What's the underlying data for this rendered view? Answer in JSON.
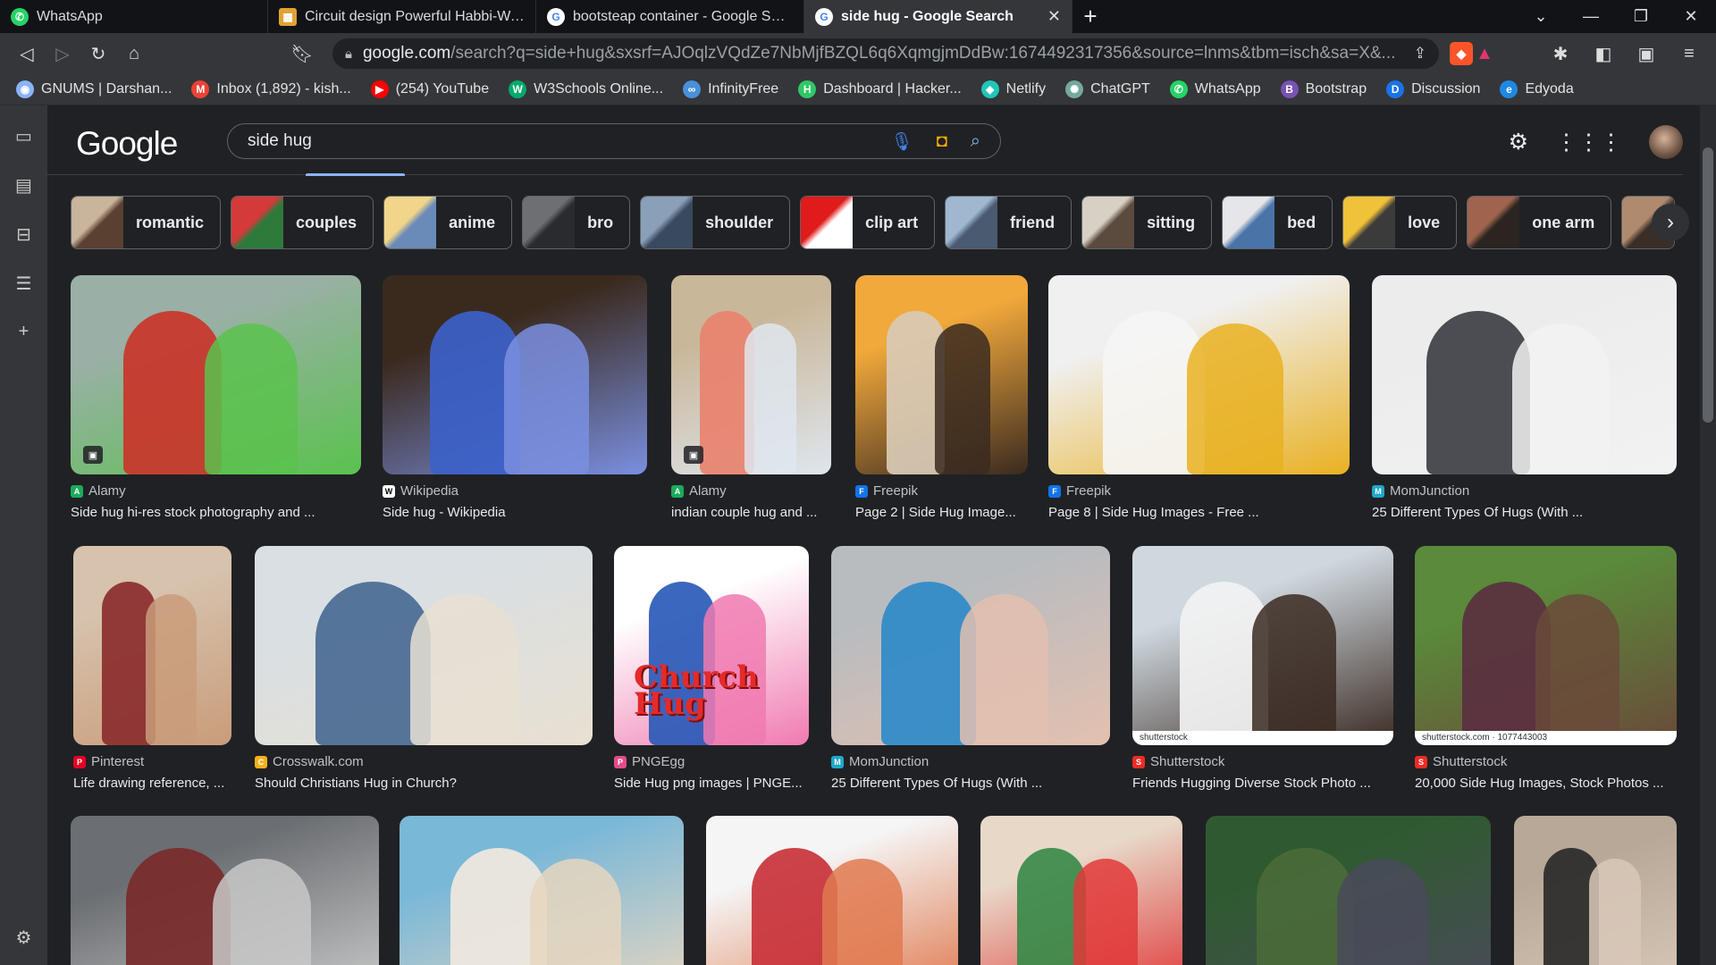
{
  "browser": {
    "tabs": [
      {
        "title": "WhatsApp",
        "favicon_color": "#25d366",
        "favicon_glyph": "✆",
        "active": false
      },
      {
        "title": "Circuit design Powerful Habbi-Waasa",
        "favicon_color": "#e0a234",
        "favicon_glyph": "▦",
        "active": false
      },
      {
        "title": "bootsteap container - Google Search",
        "favicon_color": "#ffffff",
        "favicon_glyph": "G",
        "active": false
      },
      {
        "title": "side hug - Google Search",
        "favicon_color": "#ffffff",
        "favicon_glyph": "G",
        "active": true
      }
    ],
    "new_tab_label": "+",
    "url_host": "google.com",
    "url_rest": "/search?q=side+hug&sxsrf=AJOqlzVQdZe7NbMjfBZQL6q6XqmgjmDdBw:1674492317356&source=lnms&tbm=isch&sa=X&...",
    "bookmarks": [
      {
        "label": "GNUMS | Darshan...",
        "color": "#8ab4f8",
        "glyph": "◉"
      },
      {
        "label": "Inbox (1,892) - kish...",
        "color": "#ea4335",
        "glyph": "M"
      },
      {
        "label": "(254) YouTube",
        "color": "#ff0000",
        "glyph": "▶"
      },
      {
        "label": "W3Schools Online...",
        "color": "#04aa6d",
        "glyph": "W"
      },
      {
        "label": "InfinityFree",
        "color": "#4a90d9",
        "glyph": "∞"
      },
      {
        "label": "Dashboard | Hacker...",
        "color": "#2ec866",
        "glyph": "H"
      },
      {
        "label": "Netlify",
        "color": "#20c6b7",
        "glyph": "◆"
      },
      {
        "label": "ChatGPT",
        "color": "#74aa9c",
        "glyph": "✺"
      },
      {
        "label": "WhatsApp",
        "color": "#25d366",
        "glyph": "✆"
      },
      {
        "label": "Bootstrap",
        "color": "#7952b3",
        "glyph": "B"
      },
      {
        "label": "Discussion",
        "color": "#1a73e8",
        "glyph": "D"
      },
      {
        "label": "Edyoda",
        "color": "#1e88e5",
        "glyph": "e"
      }
    ]
  },
  "google": {
    "logo": "Google",
    "query": "side hug",
    "chips": [
      {
        "label": "romantic",
        "c1": "#c9b49c",
        "c2": "#5a4030"
      },
      {
        "label": "couples",
        "c1": "#d43a3a",
        "c2": "#2e7a3a"
      },
      {
        "label": "anime",
        "c1": "#f1d58a",
        "c2": "#6a8bb8"
      },
      {
        "label": "bro",
        "c1": "#6d6f73",
        "c2": "#2a2b2f"
      },
      {
        "label": "shoulder",
        "c1": "#8aa0b8",
        "c2": "#3a4a5e"
      },
      {
        "label": "clip art",
        "c1": "#e01b1b",
        "c2": "#ffffff"
      },
      {
        "label": "friend",
        "c1": "#9fb8d0",
        "c2": "#4a5a70"
      },
      {
        "label": "sitting",
        "c1": "#d8d0c4",
        "c2": "#5b4a3e"
      },
      {
        "label": "bed",
        "c1": "#e6e6ea",
        "c2": "#4a74a8"
      },
      {
        "label": "love",
        "c1": "#f0c23a",
        "c2": "#3b3b3b"
      },
      {
        "label": "one arm",
        "c1": "#a0644e",
        "c2": "#2b2420"
      },
      {
        "label": "",
        "c1": "#b08a6e",
        "c2": "#3a2e28"
      }
    ],
    "results_row1": [
      {
        "source": "Alamy",
        "title": "Side hug hi-res stock photography and ...",
        "favcolor": "#1aab5c",
        "c1": "#9ab0a6",
        "c2": "#c9352a",
        "c3": "#5ac24e",
        "badge": true
      },
      {
        "source": "Wikipedia",
        "title": "Side hug - Wikipedia",
        "favcolor": "#ffffff",
        "c1": "#3a2a1e",
        "c2": "#3c61c9",
        "c3": "#7a8fe0",
        "badge": false
      },
      {
        "source": "Alamy",
        "title": "indian couple hug and ...",
        "favcolor": "#1aab5c",
        "c1": "#c9b79a",
        "c2": "#e8826f",
        "c3": "#dfe6ee",
        "badge": true
      },
      {
        "source": "Freepik",
        "title": "Page 2 | Side Hug Image...",
        "favcolor": "#1273eb",
        "c1": "#f2a93b",
        "c2": "#d9cab5",
        "c3": "#3a2a20",
        "badge": false
      },
      {
        "source": "Freepik",
        "title": "Page 8 | Side Hug Images - Free ...",
        "favcolor": "#1273eb",
        "c1": "#f0f0f0",
        "c2": "#f5f5f5",
        "c3": "#e9b122",
        "badge": false
      },
      {
        "source": "MomJunction",
        "title": "25 Different Types Of Hugs (With ...",
        "favcolor": "#20a7c9",
        "c1": "#ececec",
        "c2": "#3d3f44",
        "c3": "#f2f2f2",
        "badge": false
      }
    ],
    "results_row2": [
      {
        "source": "Pinterest",
        "title": "Life drawing reference, ...",
        "favcolor": "#e60023",
        "c1": "#d6c2ad",
        "c2": "#8b2e2e",
        "c3": "#c99c7a",
        "badge": false
      },
      {
        "source": "Crosswalk.com",
        "title": "Should Christians Hug in Church?",
        "favcolor": "#f5b21b",
        "c1": "#d9dfe3",
        "c2": "#4a6a92",
        "c3": "#e8e0d2",
        "badge": false
      },
      {
        "source": "PNGEgg",
        "title": "Side Hug png images | PNGE...",
        "favcolor": "#e34b8a",
        "c1": "#ffffff",
        "c2": "#2a5ab8",
        "c3": "#f07ab0",
        "badge": false,
        "art_text": "Church Hug"
      },
      {
        "source": "MomJunction",
        "title": "25 Different Types Of Hugs (With ...",
        "favcolor": "#20a7c9",
        "c1": "#b9bcbf",
        "c2": "#2f8ac9",
        "c3": "#e3c0b0",
        "badge": false
      },
      {
        "source": "Shutterstock",
        "title": "Friends Hugging Diverse Stock Photo ...",
        "favcolor": "#ee2b24",
        "c1": "#cfd8df",
        "c2": "#f2f2f2",
        "c3": "#3a2a22",
        "badge": false,
        "watermark": "shutterstock"
      },
      {
        "source": "Shutterstock",
        "title": "20,000 Side Hug Images, Stock Photos ...",
        "favcolor": "#ee2b24",
        "c1": "#5a8a3a",
        "c2": "#5a3040",
        "c3": "#6a4a3a",
        "badge": false,
        "watermark": "shutterstock.com · 1077443003"
      }
    ],
    "results_row3": [
      {
        "c1": "#6b6e72",
        "c2": "#7a2a2a",
        "c3": "#c8c8c8"
      },
      {
        "c1": "#7ab8d8",
        "c2": "#f0e8de",
        "c3": "#e6d6c0"
      },
      {
        "c1": "#f5f5f5",
        "c2": "#c8323a",
        "c3": "#e07a50"
      },
      {
        "c1": "#e8d8c8",
        "c2": "#3a8a4a",
        "c3": "#e03a3a"
      },
      {
        "c1": "#2f5a30",
        "c2": "#4a6a3a",
        "c3": "#4a4a5a"
      },
      {
        "c1": "#b8a898",
        "c2": "#2a2a2a",
        "c3": "#d8c8b8"
      }
    ]
  }
}
